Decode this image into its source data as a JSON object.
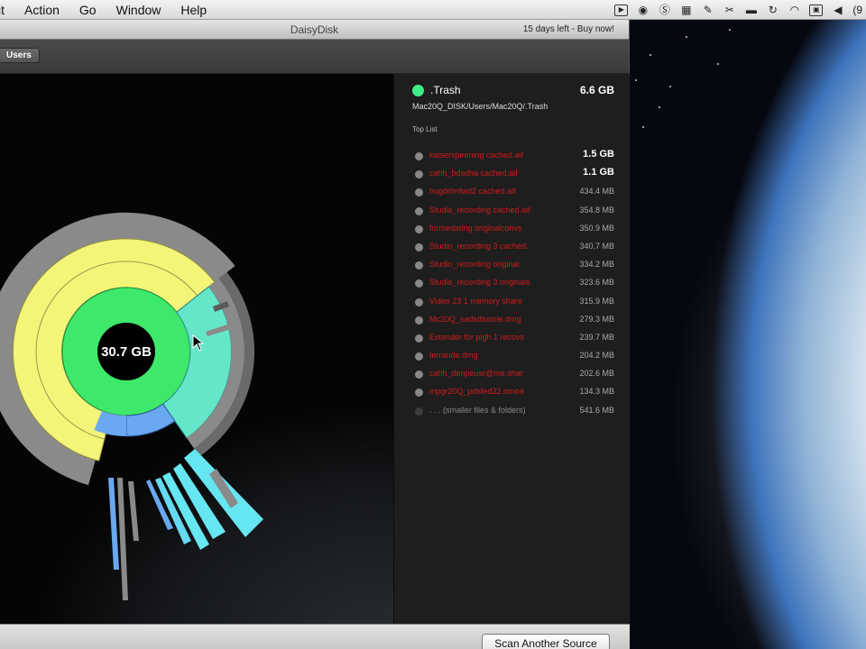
{
  "menubar": {
    "items": [
      "it",
      "Action",
      "Go",
      "Window",
      "Help"
    ],
    "extras_text": "(9"
  },
  "window": {
    "title": "DaisyDisk",
    "trial_notice": "15 days left - Buy now!"
  },
  "toolbar": {
    "breadcrumb": "Users"
  },
  "chart": {
    "center_label": "30.7 GB"
  },
  "info": {
    "selected_name": ".Trash",
    "selected_size": "6.6 GB",
    "path": "Mac20Q_DISK/Users/Mac20Q/.Trash",
    "top_list_label": "Top List",
    "top_list": [
      {
        "name": "kaiserspeening cached.aif",
        "size": "1.5 GB"
      },
      {
        "name": "cahh_bdsdha cached.aif",
        "size": "1.1 GB"
      },
      {
        "name": "hugdrhnfwd2 cached.aif",
        "size": "434.4 MB"
      },
      {
        "name": "Studio_recording cached.aif",
        "size": "354.8 MB"
      },
      {
        "name": "formedating originalconvs",
        "size": "350.9 MB"
      },
      {
        "name": "Studio_recording 3 cached.",
        "size": "340.7 MB"
      },
      {
        "name": "Studio_recording original.",
        "size": "334.2 MB"
      },
      {
        "name": "Studio_recording 3 originals",
        "size": "323.6 MB"
      },
      {
        "name": "Video 23 1 memory share",
        "size": "315.9 MB"
      },
      {
        "name": "Mc20Q_sadsdsxsrie.dmg",
        "size": "279.3 MB"
      },
      {
        "name": "Extender for pigh 1 recovs",
        "size": "239.7 MB"
      },
      {
        "name": "terrande.dmg",
        "size": "204.2 MB"
      },
      {
        "name": "cahh_denpeusr@me.shar",
        "size": "202.6 MB"
      },
      {
        "name": "mpgr20Q_pdsfed22.omoa",
        "size": "134.3 MB"
      },
      {
        "name": ". . . (smaller files & folders)",
        "size": "541.6 MB"
      }
    ]
  },
  "statusbar": {
    "scan_button": "Scan Another Source"
  },
  "colors": {
    "ring_green": "#3ee86a",
    "ring_yellow": "#f2f477",
    "ring_cyan": "#66e6e6",
    "ring_blue": "#6aa8f0",
    "ring_gray": "#8a8a8a",
    "list_red": "#d21a1a",
    "selected_dot": "#3ef08a"
  },
  "icons": [
    "apple-icon",
    "monitor-icon",
    "sync-icon",
    "skype-icon",
    "calendar-icon",
    "evernote-icon",
    "tools-icon",
    "printer-icon",
    "timemachine-icon",
    "wifi-icon",
    "screen-icon",
    "volume-icon"
  ]
}
